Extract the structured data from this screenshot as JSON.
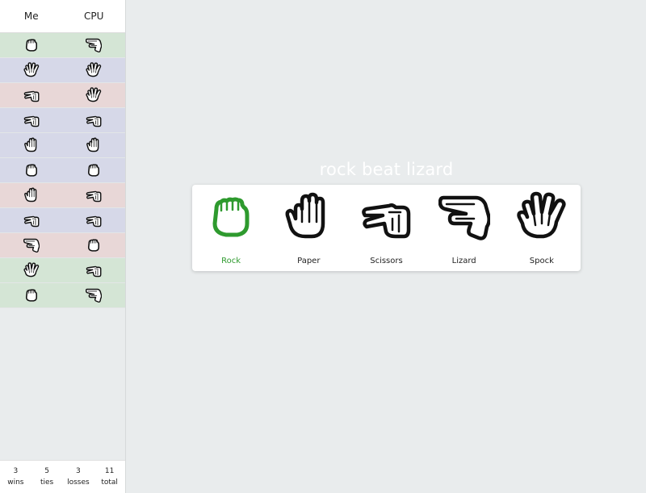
{
  "history": {
    "me_label": "Me",
    "cpu_label": "CPU",
    "rows": [
      {
        "outcome": "win",
        "me": "rock-icon",
        "cpu": "lizard-icon"
      },
      {
        "outcome": "tie",
        "me": "spock-icon",
        "cpu": "spock-icon"
      },
      {
        "outcome": "loss",
        "me": "scissors-icon",
        "cpu": "spock-icon"
      },
      {
        "outcome": "tie",
        "me": "scissors-icon",
        "cpu": "scissors-icon"
      },
      {
        "outcome": "tie",
        "me": "paper-icon",
        "cpu": "paper-icon"
      },
      {
        "outcome": "tie",
        "me": "rock-icon",
        "cpu": "rock-icon"
      },
      {
        "outcome": "loss",
        "me": "paper-icon",
        "cpu": "scissors-icon"
      },
      {
        "outcome": "tie",
        "me": "scissors-icon",
        "cpu": "scissors-icon"
      },
      {
        "outcome": "loss",
        "me": "lizard-icon",
        "cpu": "rock-icon"
      },
      {
        "outcome": "win",
        "me": "spock-icon",
        "cpu": "scissors-icon"
      },
      {
        "outcome": "win",
        "me": "rock-icon",
        "cpu": "lizard-icon"
      }
    ]
  },
  "stats": {
    "wins": {
      "value": "3",
      "label": "wins"
    },
    "ties": {
      "value": "5",
      "label": "ties"
    },
    "losses": {
      "value": "3",
      "label": "losses"
    },
    "total": {
      "value": "11",
      "label": "total"
    }
  },
  "result_text": "rock beat lizard",
  "choices": [
    {
      "label": "Rock",
      "icon": "rock-icon",
      "selected": true
    },
    {
      "label": "Paper",
      "icon": "paper-icon",
      "selected": false
    },
    {
      "label": "Scissors",
      "icon": "scissors-icon",
      "selected": false
    },
    {
      "label": "Lizard",
      "icon": "lizard-icon",
      "selected": false
    },
    {
      "label": "Spock",
      "icon": "spock-icon",
      "selected": false
    }
  ],
  "colors": {
    "win_row": "#d4e5d5",
    "tie_row": "#d6d8e8",
    "loss_row": "#e8d7d7",
    "selected": "#2e9a2e",
    "icon": "#111111"
  }
}
